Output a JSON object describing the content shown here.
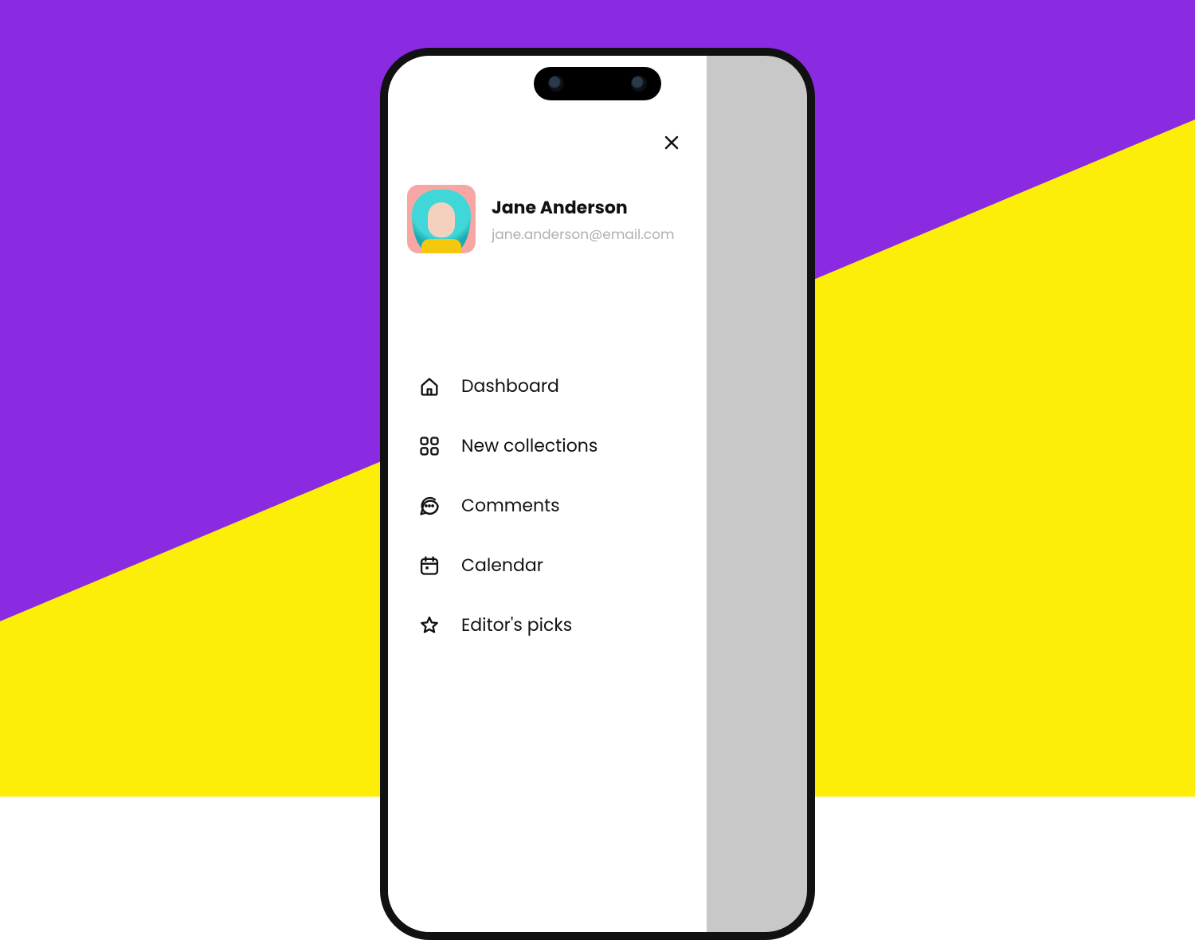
{
  "profile": {
    "name": "Jane Anderson",
    "email": "jane.anderson@email.com"
  },
  "menu": {
    "dashboard": {
      "label": "Dashboard"
    },
    "new_collections": {
      "label": "New collections"
    },
    "comments": {
      "label": "Comments"
    },
    "calendar": {
      "label": "Calendar"
    },
    "editors_picks": {
      "label": "Editor's picks"
    }
  }
}
